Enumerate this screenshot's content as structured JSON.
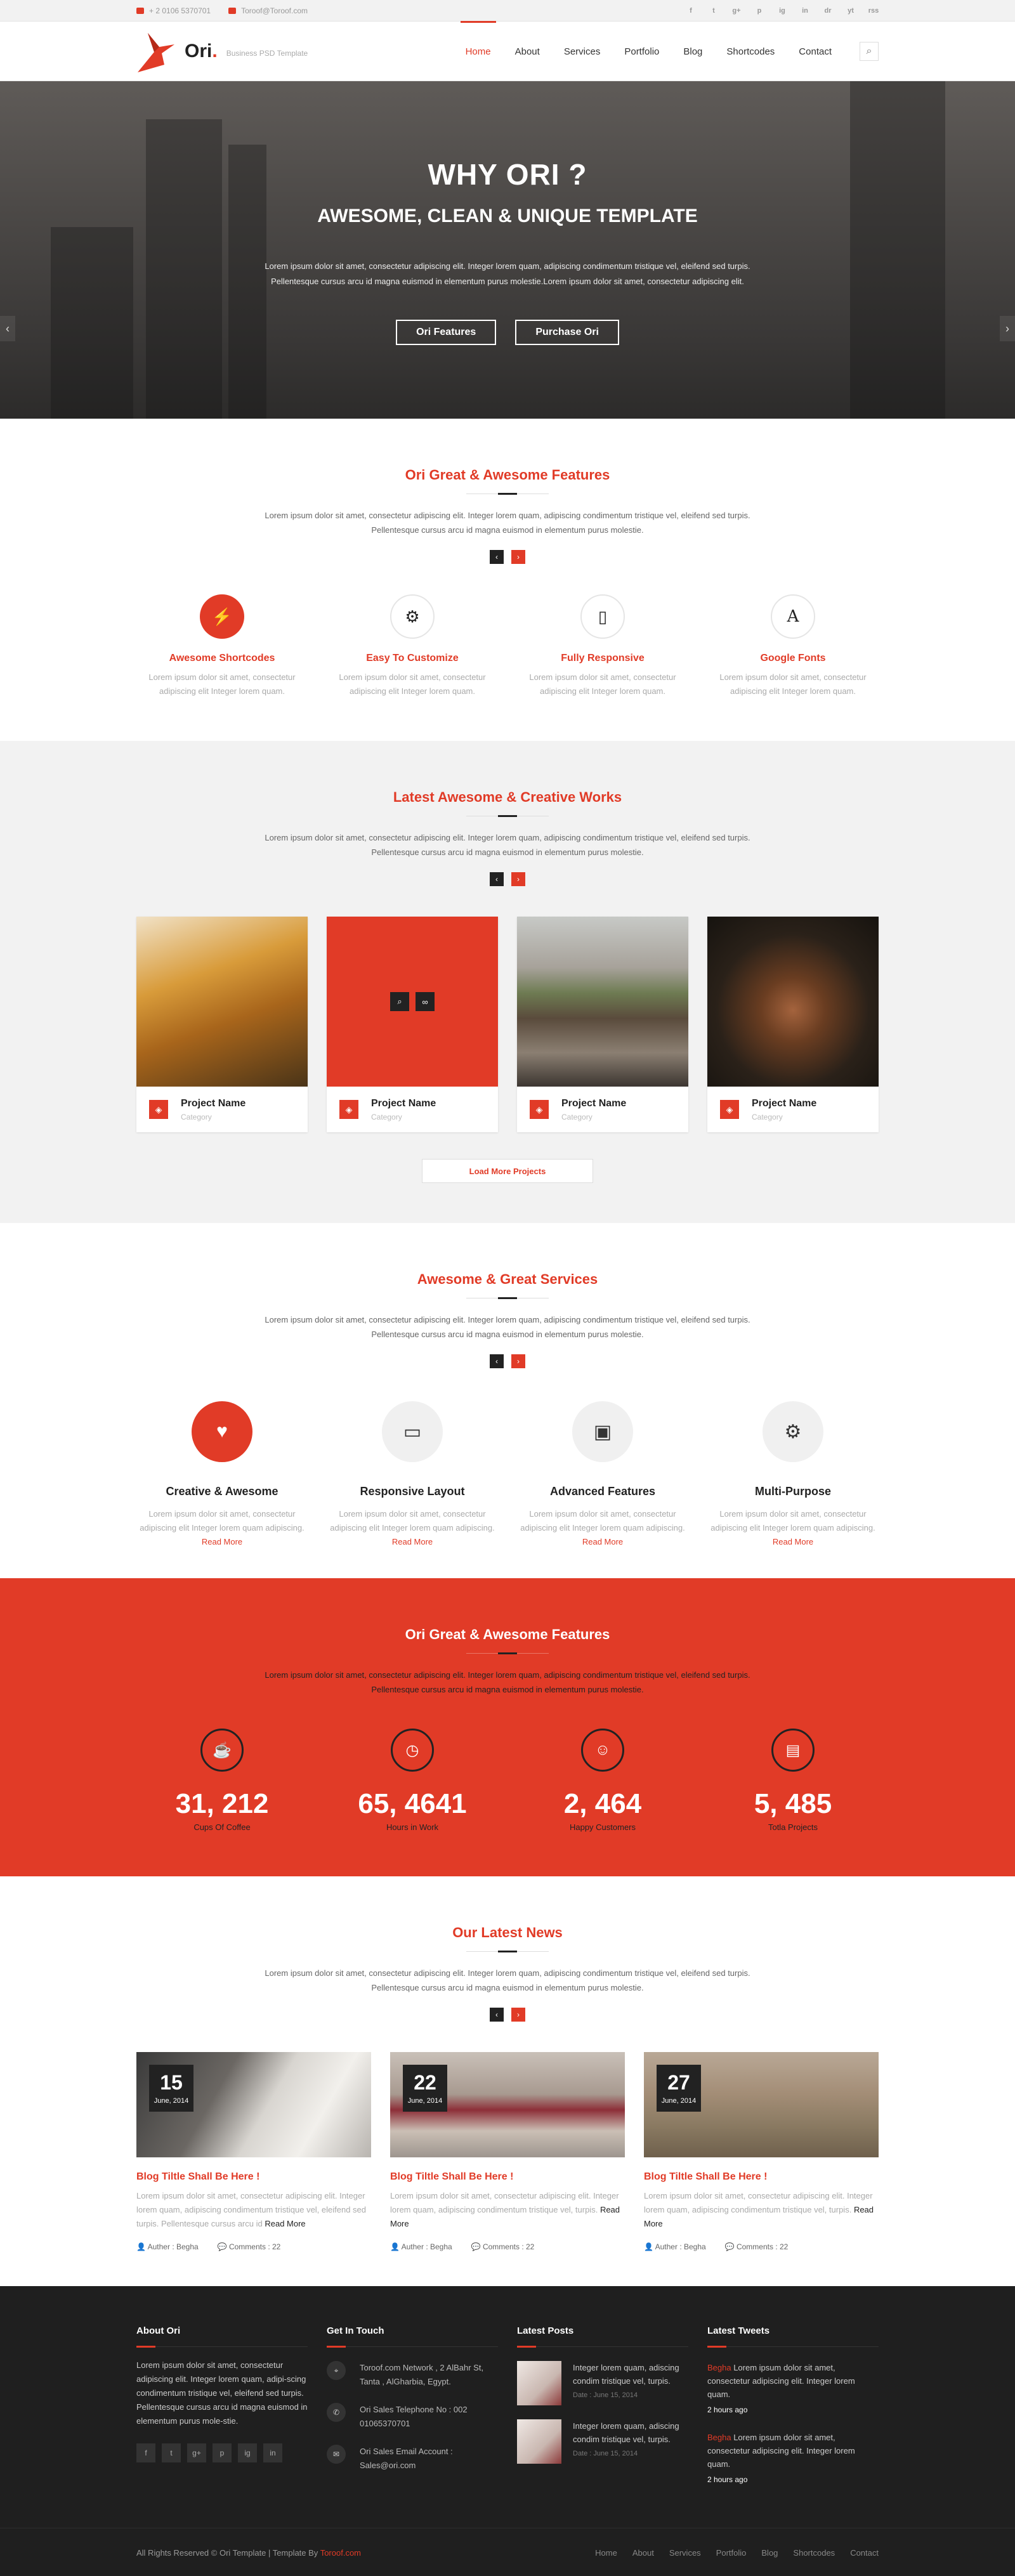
{
  "topbar": {
    "phone": "+ 2 0106 5370701",
    "email": "Toroof@Toroof.com",
    "socials": [
      "f",
      "t",
      "g+",
      "p",
      "in",
      "ig",
      "li",
      "dr",
      "yt",
      "rss"
    ]
  },
  "header": {
    "logo_name": "Ori",
    "logo_dot": ".",
    "logo_tagline": "Business PSD Template",
    "nav": [
      "Home",
      "About",
      "Services",
      "Portfolio",
      "Blog",
      "Shortcodes",
      "Contact"
    ]
  },
  "hero": {
    "title": "WHY ORI ?",
    "subtitle": "AWESOME, CLEAN & UNIQUE TEMPLATE",
    "text": "Lorem ipsum dolor sit amet, consectetur adipiscing elit. Integer lorem quam, adipiscing condimentum tristique vel, eleifend sed turpis. Pellentesque cursus arcu id magna euismod in elementum purus molestie.Lorem ipsum dolor sit amet, consectetur adipiscing elit.",
    "btn1": "Ori Features",
    "btn2": "Purchase Ori"
  },
  "features": {
    "title": "Ori Great & Awesome Features",
    "desc": "Lorem ipsum dolor sit amet, consectetur adipiscing elit. Integer lorem quam, adipiscing condimentum tristique vel, eleifend sed turpis. Pellentesque cursus arcu id magna euismod in elementum purus molestie.",
    "items": [
      {
        "icon": "⚡",
        "title": "Awesome Shortcodes",
        "text": "Lorem ipsum dolor sit amet, consectetur adipiscing elit Integer lorem quam."
      },
      {
        "icon": "⚙",
        "title": "Easy To Customize",
        "text": "Lorem ipsum dolor sit amet, consectetur adipiscing elit Integer lorem quam."
      },
      {
        "icon": "▯",
        "title": "Fully Responsive",
        "text": "Lorem ipsum dolor sit amet, consectetur adipiscing elit Integer lorem quam."
      },
      {
        "icon": "A",
        "title": "Google Fonts",
        "text": "Lorem ipsum dolor sit amet, consectetur adipiscing elit Integer lorem quam."
      }
    ]
  },
  "works": {
    "title": "Latest Awesome & Creative Works",
    "desc": "Lorem ipsum dolor sit amet, consectetur adipiscing elit. Integer lorem quam, adipiscing condimentum tristique vel, eleifend sed turpis. Pellentesque cursus arcu id magna euismod in elementum purus molestie.",
    "items": [
      {
        "name": "Project Name",
        "cat": "Category"
      },
      {
        "name": "Project Name",
        "cat": "Category"
      },
      {
        "name": "Project Name",
        "cat": "Category"
      },
      {
        "name": "Project Name",
        "cat": "Category"
      }
    ],
    "load_more": "Load More Projects"
  },
  "services": {
    "title": "Awesome & Great Services",
    "desc": "Lorem ipsum dolor sit amet, consectetur adipiscing elit. Integer lorem quam, adipiscing condimentum tristique vel, eleifend sed turpis. Pellentesque cursus arcu id magna euismod in elementum purus molestie.",
    "read_more": "Read More",
    "items": [
      {
        "icon": "♥",
        "title": "Creative & Awesome",
        "text": "Lorem ipsum dolor sit amet, consectetur adipiscing elit Integer lorem quam adipiscing."
      },
      {
        "icon": "▭",
        "title": "Responsive Layout",
        "text": "Lorem ipsum dolor sit amet, consectetur adipiscing elit Integer lorem quam adipiscing."
      },
      {
        "icon": "▣",
        "title": "Advanced Features",
        "text": "Lorem ipsum dolor sit amet, consectetur adipiscing elit Integer lorem quam adipiscing."
      },
      {
        "icon": "⚙",
        "title": "Multi-Purpose",
        "text": "Lorem ipsum dolor sit amet, consectetur adipiscing elit Integer lorem quam adipiscing."
      }
    ]
  },
  "stats": {
    "title": "Ori Great & Awesome Features",
    "desc": "Lorem ipsum dolor sit amet, consectetur adipiscing elit. Integer lorem quam, adipiscing condimentum tristique vel, eleifend sed turpis. Pellentesque cursus arcu id magna euismod in elementum purus molestie.",
    "items": [
      {
        "icon": "☕",
        "num": "31, 212",
        "label": "Cups Of Coffee"
      },
      {
        "icon": "◷",
        "num": "65, 4641",
        "label": "Hours in Work"
      },
      {
        "icon": "☺",
        "num": "2, 464",
        "label": "Happy Customers"
      },
      {
        "icon": "▤",
        "num": "5, 485",
        "label": "Totla Projects"
      }
    ]
  },
  "news": {
    "title": "Our Latest News",
    "desc": "Lorem ipsum dolor sit amet, consectetur adipiscing elit. Integer lorem quam, adipiscing condimentum tristique vel, eleifend sed turpis. Pellentesque cursus arcu id magna euismod in elementum purus molestie.",
    "items": [
      {
        "day": "15",
        "month": "June, 2014",
        "title": "Blog Tiltle Shall Be Here !",
        "text": "Lorem ipsum dolor sit amet, consectetur adipiscing elit. Integer lorem quam, adipiscing condimentum tristique vel, eleifend sed turpis. Pellentesque cursus arcu id",
        "more": "Read More",
        "author": "Auther : Begha",
        "comments": "Comments : 22"
      },
      {
        "day": "22",
        "month": "June, 2014",
        "title": "Blog Tiltle Shall Be Here !",
        "text": "Lorem ipsum dolor sit amet, consectetur adipiscing elit. Integer lorem quam, adipiscing condimentum tristique vel, turpis.",
        "more": "Read More",
        "author": "Auther : Begha",
        "comments": "Comments : 22"
      },
      {
        "day": "27",
        "month": "June, 2014",
        "title": "Blog Tiltle Shall Be Here !",
        "text": "Lorem ipsum dolor sit amet, consectetur adipiscing elit. Integer lorem quam, adipiscing condimentum tristique vel, turpis.",
        "more": "Read More",
        "author": "Auther : Begha",
        "comments": "Comments : 22"
      }
    ]
  },
  "footer": {
    "about_title": "About Ori",
    "about_text": "Lorem ipsum dolor sit amet, consectetur adipiscing elit. Integer lorem quam, adipi-scing condimentum tristique vel, eleifend sed turpis. Pellentesque cursus arcu id magna euismod in elementum purus mole-stie.",
    "socials": [
      "f",
      "t",
      "g+",
      "p",
      "ig",
      "in"
    ],
    "touch_title": "Get In Touch",
    "touch": [
      {
        "icon": "⌖",
        "text": "Toroof.com Network , 2 AlBahr St, Tanta , AlGharbia, Egypt."
      },
      {
        "icon": "✆",
        "text": "Ori Sales Telephone No : 002 01065370701"
      },
      {
        "icon": "✉",
        "text": "Ori Sales Email Account : Sales@ori.com"
      }
    ],
    "posts_title": "Latest Posts",
    "posts": [
      {
        "text": "Integer lorem quam, adiscing condim tristique vel, turpis.",
        "date": "Date : June 15, 2014"
      },
      {
        "text": "Integer lorem quam, adiscing condim tristique vel, turpis.",
        "date": "Date : June 15, 2014"
      }
    ],
    "tweets_title": "Latest Tweets",
    "tweets": [
      {
        "user": "Begha",
        "text": " Lorem ipsum dolor sit amet, consectetur adipiscing elit. Integer lorem quam.",
        "ago": "2 hours ago"
      },
      {
        "user": "Begha",
        "text": " Lorem ipsum dolor sit amet, consectetur adipiscing elit. Integer lorem quam.",
        "ago": "2 hours ago"
      }
    ],
    "copyright": "All Rights Reserved © Ori Template  |  Template By ",
    "copyright_by": "Toroof.com",
    "links": [
      "Home",
      "About",
      "Services",
      "Portfolio",
      "Blog",
      "Shortcodes",
      "Contact"
    ]
  }
}
